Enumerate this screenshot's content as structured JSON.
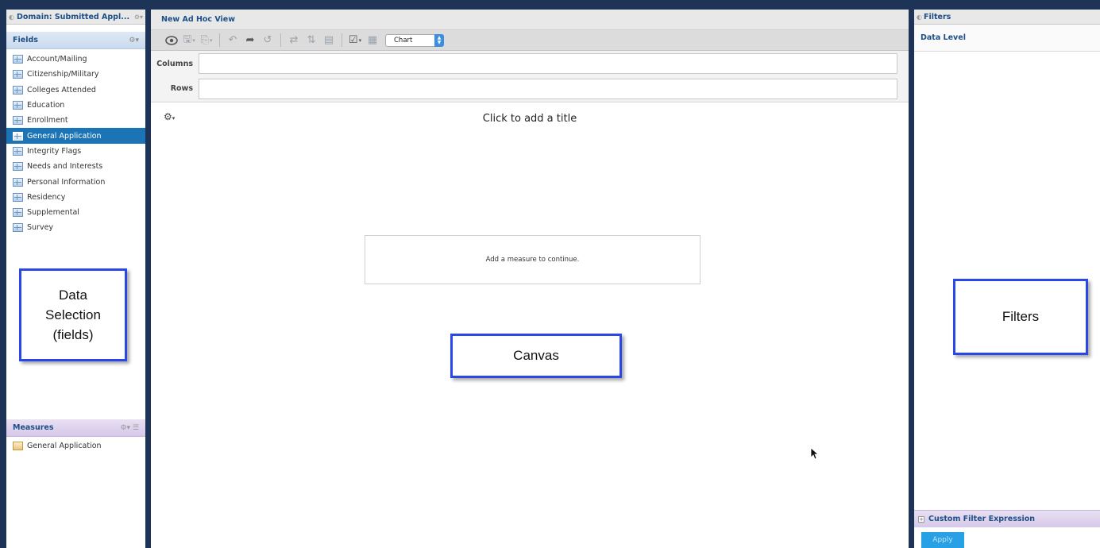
{
  "left_panel": {
    "domain_title": "Domain: Submitted Appl...",
    "fields_header": "Fields",
    "fields": [
      {
        "label": "Account/Mailing",
        "selected": false
      },
      {
        "label": "Citizenship/Military",
        "selected": false
      },
      {
        "label": "Colleges Attended",
        "selected": false
      },
      {
        "label": "Education",
        "selected": false
      },
      {
        "label": "Enrollment",
        "selected": false
      },
      {
        "label": "General Application",
        "selected": true
      },
      {
        "label": "Integrity Flags",
        "selected": false
      },
      {
        "label": "Needs and Interests",
        "selected": false
      },
      {
        "label": "Personal Information",
        "selected": false
      },
      {
        "label": "Residency",
        "selected": false
      },
      {
        "label": "Supplemental",
        "selected": false
      },
      {
        "label": "Survey",
        "selected": false
      }
    ],
    "measures_header": "Measures",
    "measures": [
      {
        "label": "General Application"
      }
    ]
  },
  "center_panel": {
    "view_title": "New Ad Hoc View",
    "toolbar": {
      "view_type": "Chart"
    },
    "axes": {
      "columns_label": "Columns",
      "rows_label": "Rows"
    },
    "canvas": {
      "title_placeholder": "Click to add a title",
      "empty_message": "Add a measure to continue."
    }
  },
  "right_panel": {
    "filters_title": "Filters",
    "data_level_label": "Data Level",
    "custom_filter_label": "Custom Filter Expression",
    "apply_label": "Apply"
  },
  "annotations": {
    "data_selection": [
      "Data",
      "Selection",
      "(fields)"
    ],
    "canvas": "Canvas",
    "filters": "Filters"
  },
  "colors": {
    "frame": "#1d3456",
    "selected_row": "#1b74b6",
    "header_text": "#1d4f86",
    "callout_border": "#2a48e8",
    "apply_button": "#28a0e6"
  }
}
